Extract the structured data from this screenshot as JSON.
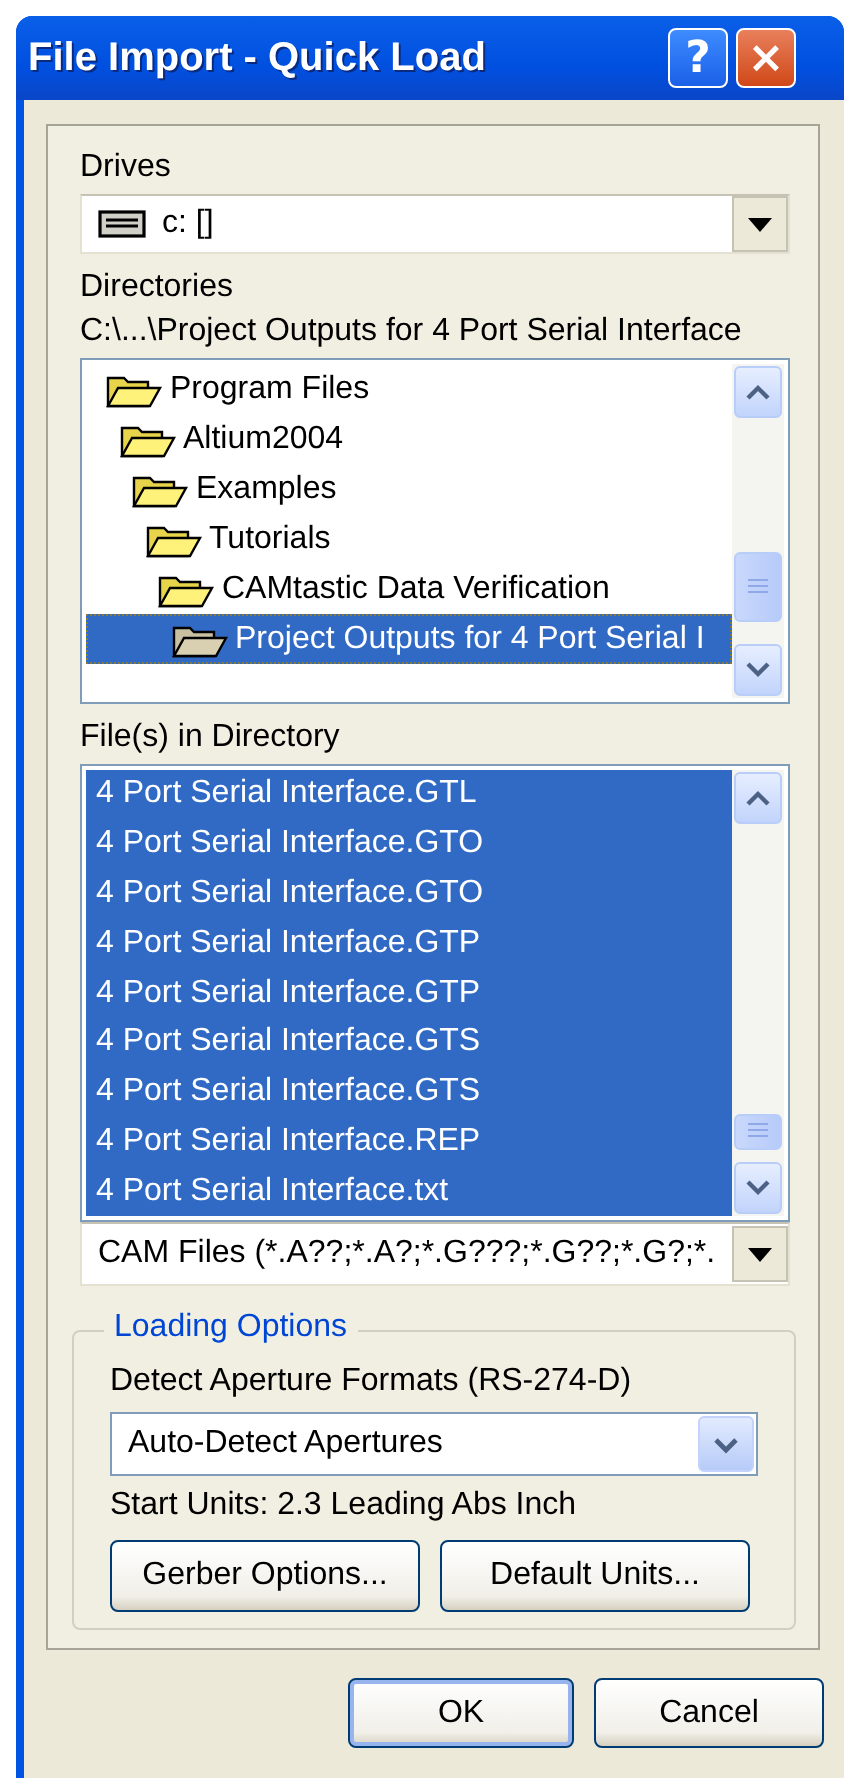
{
  "window": {
    "title": "File Import - Quick Load",
    "help_button": "?",
    "close_button": "×"
  },
  "drives": {
    "label": "Drives",
    "value": "c: []"
  },
  "directories": {
    "label": "Directories",
    "path": "C:\\...\\Project Outputs for 4 Port Serial Interface",
    "tree": [
      {
        "label": "Program Files",
        "selected": false,
        "children": [
          {
            "label": "Altium2004",
            "selected": false,
            "children": [
              {
                "label": "Examples",
                "selected": false,
                "children": [
                  {
                    "label": "Tutorials",
                    "selected": false,
                    "children": [
                      {
                        "label": "CAMtastic Data Verification",
                        "selected": false,
                        "children": [
                          {
                            "label": "Project Outputs for 4 Port Serial I",
                            "selected": true
                          }
                        ]
                      }
                    ]
                  }
                ]
              }
            ]
          }
        ]
      }
    ]
  },
  "files": {
    "label": "File(s) in Directory",
    "items": [
      {
        "label": "4 Port Serial Interface.GTL",
        "selected": true
      },
      {
        "label": "4 Port Serial Interface.GTO",
        "selected": true
      },
      {
        "label": "4 Port Serial Interface.GTO",
        "selected": true
      },
      {
        "label": "4 Port Serial Interface.GTP",
        "selected": true
      },
      {
        "label": "4 Port Serial Interface.GTP",
        "selected": true
      },
      {
        "label": "4 Port Serial Interface.GTS",
        "selected": true
      },
      {
        "label": "4 Port Serial Interface.GTS",
        "selected": true
      },
      {
        "label": "4 Port Serial Interface.REP",
        "selected": true
      },
      {
        "label": "4 Port Serial Interface.txt",
        "selected": true
      }
    ],
    "filter": "CAM Files (*.A??;*.A?;*.G???;*.G??;*.G?;*."
  },
  "loading_options": {
    "title": "Loading Options",
    "aperture_label": "Detect Aperture Formats (RS-274-D)",
    "aperture_value": "Auto-Detect Apertures",
    "start_units": "Start Units: 2.3 Leading Abs Inch",
    "buttons": [
      "Gerber Options...",
      "Default Units..."
    ]
  },
  "buttons": [
    {
      "label": "OK",
      "default": true
    },
    {
      "label": "Cancel",
      "default": false
    }
  ]
}
